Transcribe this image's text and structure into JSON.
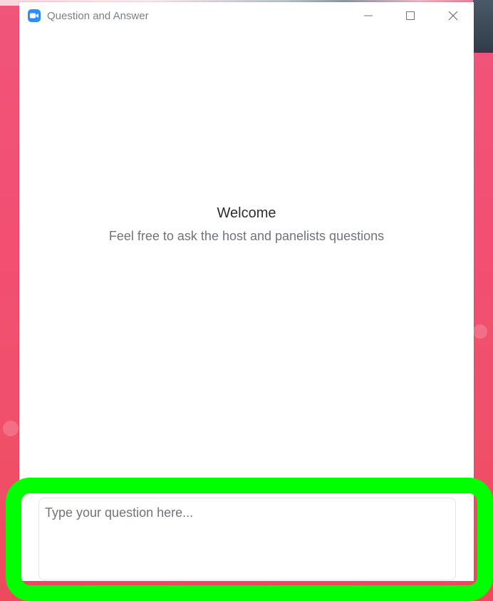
{
  "window": {
    "title": "Question and Answer"
  },
  "content": {
    "welcome": "Welcome",
    "subtitle": "Feel free to ask the host and panelists questions"
  },
  "input": {
    "placeholder": "Type your question here...",
    "value": ""
  },
  "colors": {
    "accent": "#2d8cff",
    "highlight": "#00ff00",
    "background": "#f0557a"
  },
  "icons": {
    "app": "zoom-camera-icon",
    "minimize": "minimize-icon",
    "maximize": "maximize-icon",
    "close": "close-icon"
  }
}
